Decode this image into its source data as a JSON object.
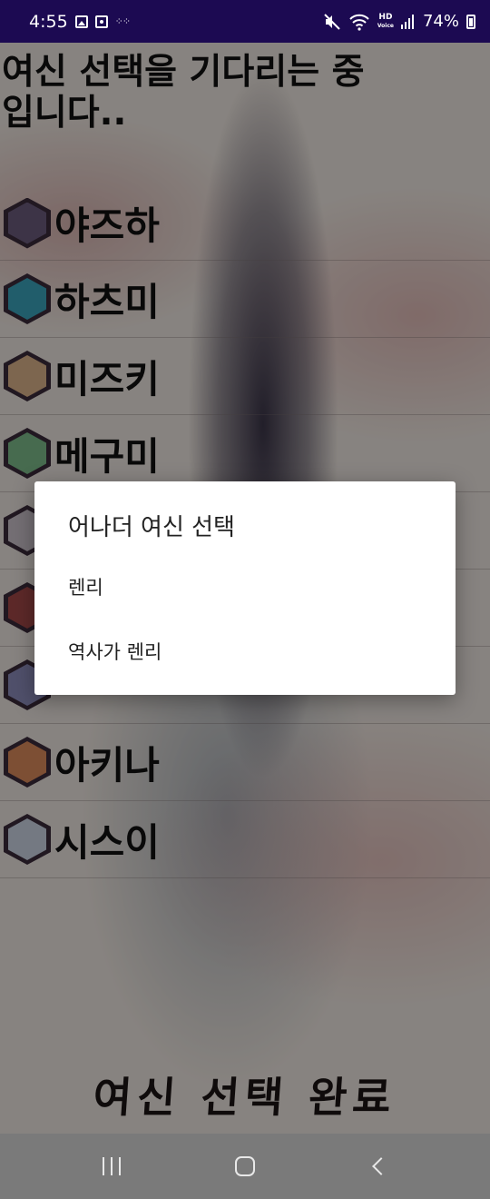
{
  "status_bar": {
    "time": "4:55",
    "battery": "74%",
    "hd_label": "HD",
    "voice_label": "Voice"
  },
  "page": {
    "title": "여신 선택을 기다리는 중입니다..",
    "complete_button": "여신 선택 완료"
  },
  "characters": [
    {
      "name": "야즈하",
      "avatar_color": "#6a5a7a"
    },
    {
      "name": "하츠미",
      "avatar_color": "#3aa0b8"
    },
    {
      "name": "미즈키",
      "avatar_color": "#d8b088"
    },
    {
      "name": "메구미",
      "avatar_color": "#7ab888"
    },
    {
      "name": "",
      "avatar_color": "#c8c0c8"
    },
    {
      "name": "",
      "avatar_color": "#a04848"
    },
    {
      "name": "",
      "avatar_color": "#8a8ab8"
    },
    {
      "name": "아키나",
      "avatar_color": "#d8885a"
    },
    {
      "name": "시스이",
      "avatar_color": "#c8d0e0"
    }
  ],
  "dialog": {
    "title": "어나더 여신 선택",
    "options": [
      "렌리",
      "역사가 렌리"
    ]
  },
  "icons": {
    "mute": "mute-icon",
    "wifi": "wifi-icon",
    "signal": "signal-icon",
    "battery": "battery-icon"
  }
}
